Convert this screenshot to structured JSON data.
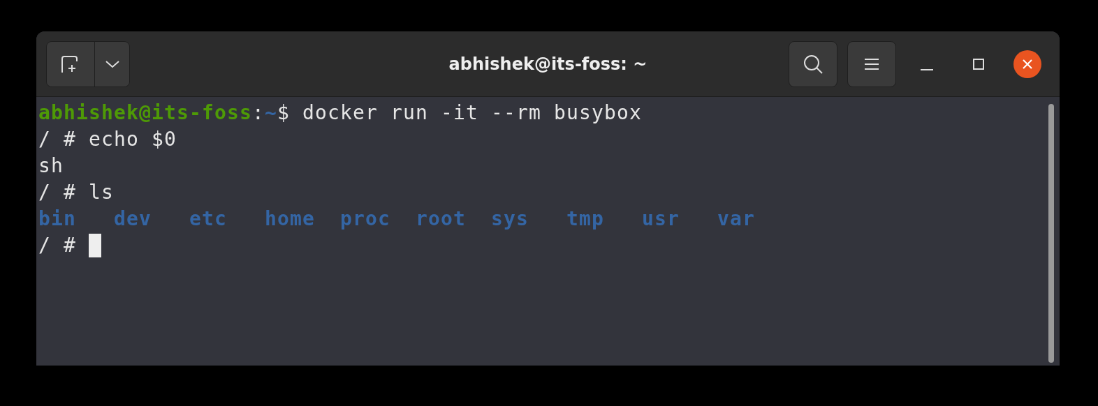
{
  "window": {
    "title": "abhishek@its-foss: ~"
  },
  "terminal": {
    "lines": [
      {
        "segments": [
          {
            "kind": "user",
            "text": "abhishek@its-foss"
          },
          {
            "kind": "plain",
            "text": ":"
          },
          {
            "kind": "path",
            "text": "~"
          },
          {
            "kind": "plain",
            "text": "$ docker run -it --rm busybox"
          }
        ]
      },
      {
        "segments": [
          {
            "kind": "plain",
            "text": "/ # echo $0"
          }
        ]
      },
      {
        "segments": [
          {
            "kind": "plain",
            "text": "sh"
          }
        ]
      },
      {
        "segments": [
          {
            "kind": "plain",
            "text": "/ # ls"
          }
        ]
      },
      {
        "segments": [
          {
            "kind": "dir",
            "text": "bin"
          },
          {
            "kind": "dir",
            "text": "dev"
          },
          {
            "kind": "dir",
            "text": "etc"
          },
          {
            "kind": "dir",
            "text": "home"
          },
          {
            "kind": "dir",
            "text": "proc"
          },
          {
            "kind": "dir",
            "text": "root"
          },
          {
            "kind": "dir",
            "text": "sys"
          },
          {
            "kind": "dir",
            "text": "tmp"
          },
          {
            "kind": "dir",
            "text": "usr"
          },
          {
            "kind": "dir",
            "text": "var"
          }
        ]
      },
      {
        "segments": [
          {
            "kind": "plain",
            "text": "/ # "
          }
        ],
        "cursor": true
      }
    ]
  }
}
